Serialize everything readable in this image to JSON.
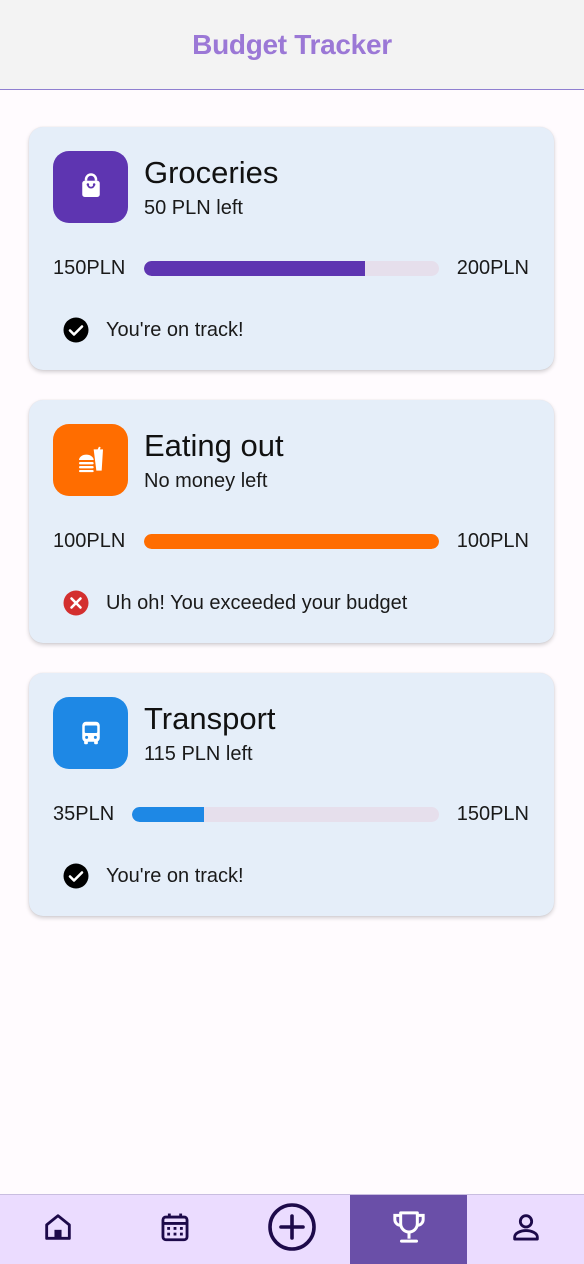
{
  "app": {
    "title": "Budget Tracker"
  },
  "budgets": [
    {
      "name": "Groceries",
      "left_text": "50 PLN left",
      "spent_label": "150PLN",
      "limit_label": "200PLN",
      "progress": 0.75,
      "color": "#5e35b1",
      "icon": "shopping-bag-icon",
      "status_text": "You're on track!",
      "status_icon": "check-circle-icon"
    },
    {
      "name": "Eating out",
      "left_text": "No money left",
      "spent_label": "100PLN",
      "limit_label": "100PLN",
      "progress": 1.0,
      "color": "#ff6d00",
      "icon": "fastfood-icon",
      "status_text": "Uh oh! You exceeded your budget",
      "status_icon": "error-circle-icon"
    },
    {
      "name": "Transport",
      "left_text": "115 PLN left",
      "spent_label": "35PLN",
      "limit_label": "150PLN",
      "progress": 0.2333,
      "color": "#1e88e5",
      "icon": "bus-icon",
      "status_text": "You're on track!",
      "status_icon": "check-circle-icon"
    }
  ],
  "nav": {
    "items": [
      "home-icon",
      "calendar-icon",
      "add-circle-icon",
      "trophy-icon",
      "person-icon"
    ],
    "active_index": 3,
    "active_color": "#6a4fa8",
    "bar_color": "#ebdcff"
  }
}
